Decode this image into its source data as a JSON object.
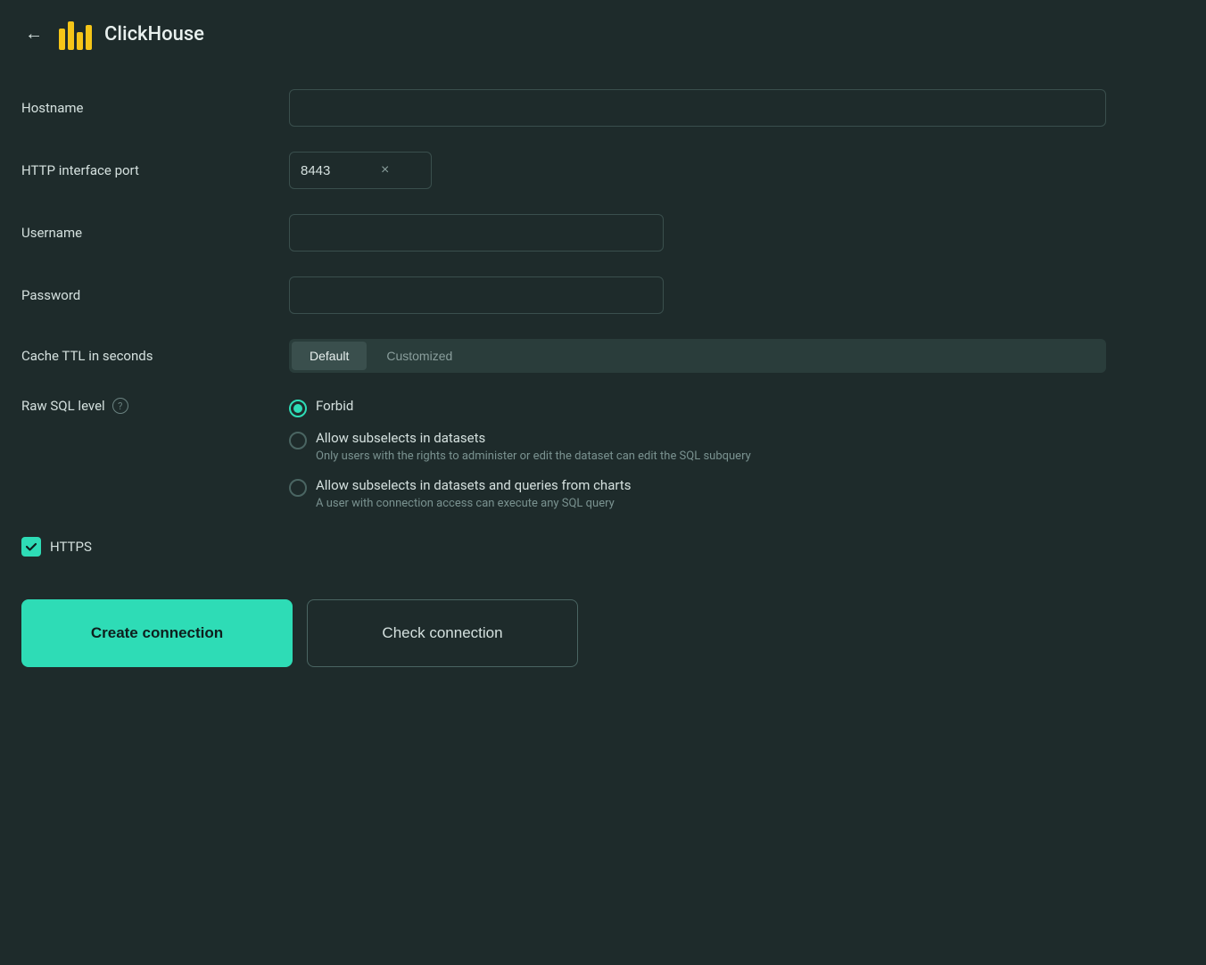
{
  "header": {
    "back_label": "←",
    "title": "ClickHouse",
    "logo_alt": "ClickHouse logo"
  },
  "form": {
    "hostname": {
      "label": "Hostname",
      "placeholder": "",
      "value": ""
    },
    "http_port": {
      "label": "HTTP interface port",
      "value": "8443",
      "clear_label": "×"
    },
    "username": {
      "label": "Username",
      "placeholder": "",
      "value": ""
    },
    "password": {
      "label": "Password",
      "placeholder": "",
      "value": ""
    },
    "cache_ttl": {
      "label": "Cache TTL in seconds",
      "options": [
        "Default",
        "Customized"
      ],
      "selected": "Default"
    },
    "raw_sql": {
      "label": "Raw SQL level",
      "help_tooltip": "?",
      "options": [
        {
          "value": "forbid",
          "label": "Forbid",
          "description": "",
          "checked": true
        },
        {
          "value": "allow_subselects",
          "label": "Allow subselects in datasets",
          "description": "Only users with the rights to administer or edit the dataset can edit the SQL subquery",
          "checked": false
        },
        {
          "value": "allow_all",
          "label": "Allow subselects in datasets and queries from charts",
          "description": "A user with connection access can execute any SQL query",
          "checked": false
        }
      ]
    },
    "https": {
      "label": "HTTPS",
      "checked": true
    }
  },
  "buttons": {
    "create": "Create connection",
    "check": "Check connection"
  }
}
